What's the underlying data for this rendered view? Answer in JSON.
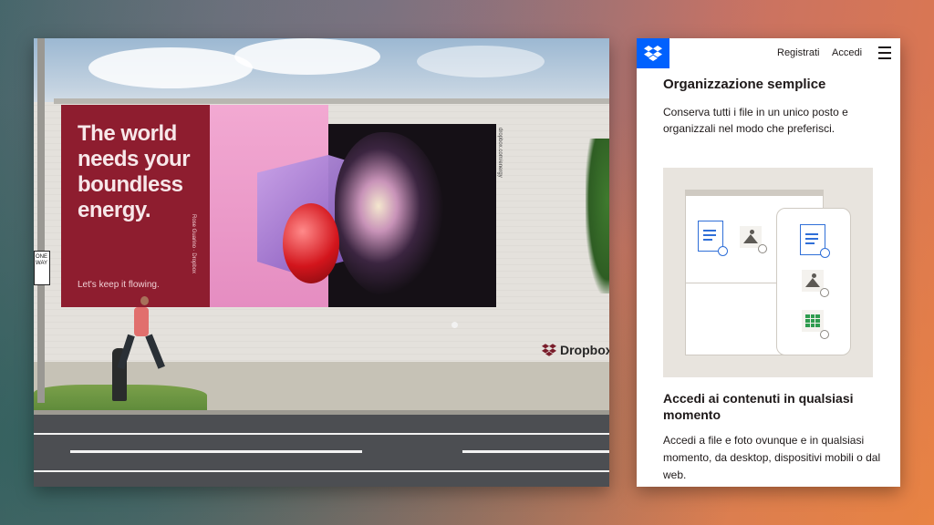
{
  "billboard": {
    "headline": "The world needs your boundless energy.",
    "tagline": "Let's keep it flowing.",
    "vertical_credit_left": "Rose Guarino · Dropbox",
    "vertical_credit_right": "dropbox.com/energy",
    "brand": "Dropbox"
  },
  "street": {
    "sign_text_line1": "ONE",
    "sign_text_line2": "WAY"
  },
  "phone": {
    "nav": {
      "register_label": "Registrati",
      "login_label": "Accedi",
      "logo_icon": "dropbox-logo-icon",
      "menu_icon": "hamburger-menu-icon"
    },
    "section1": {
      "title": "Organizzazione semplice",
      "body": "Conserva tutti i file in un unico posto e organizzali nel modo che preferisci."
    },
    "section2": {
      "title": "Accedi ai contenuti in qualsiasi momento",
      "body": "Accedi a file e foto ovunque e in qualsiasi momento, da desktop, dispositivi mobili o dal web."
    },
    "illustration_icons": [
      "document-icon",
      "image-icon",
      "spreadsheet-icon",
      "sync-badge-icon"
    ]
  },
  "colors": {
    "dropbox_blue": "#0061fe",
    "billboard_red": "#8e1d2f",
    "billboard_pink": "#f2a9d2",
    "doc_blue": "#2f6fd8",
    "sheet_green": "#2e9c4f"
  }
}
